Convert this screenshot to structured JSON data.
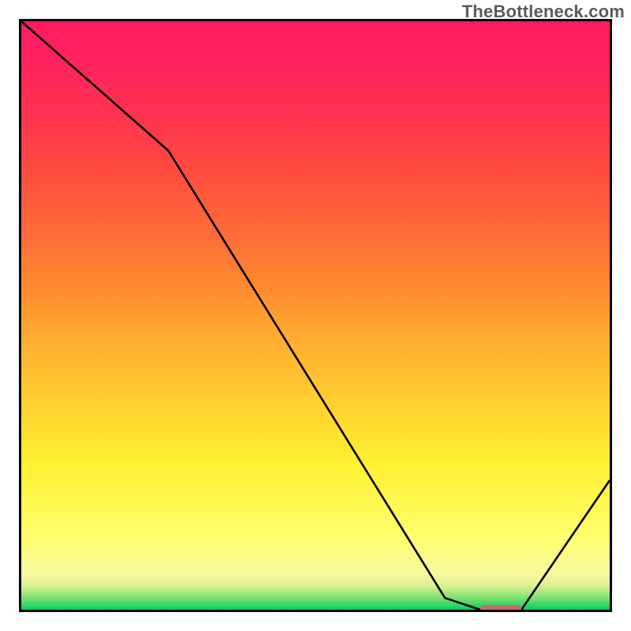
{
  "watermark": "TheBottleneck.com",
  "chart_data": {
    "type": "line",
    "title": "",
    "xlabel": "",
    "ylabel": "",
    "xlim": [
      0,
      100
    ],
    "ylim": [
      0,
      100
    ],
    "grid": false,
    "series": [
      {
        "name": "bottleneck-curve",
        "x": [
          0,
          25,
          72,
          78,
          85,
          100
        ],
        "values": [
          100,
          78,
          2,
          0,
          0,
          22
        ]
      }
    ],
    "annotations": [
      {
        "name": "optimal-marker",
        "x_range": [
          78,
          85
        ],
        "y": 0,
        "color": "#cc6a6a"
      }
    ],
    "background_gradient": {
      "direction": "bottom-to-top",
      "stops": [
        {
          "pct": 0,
          "color": "#00d060"
        },
        {
          "pct": 6,
          "color": "#f8f8a0"
        },
        {
          "pct": 25,
          "color": "#fff030"
        },
        {
          "pct": 55,
          "color": "#ff8a30"
        },
        {
          "pct": 75,
          "color": "#ff4a40"
        },
        {
          "pct": 100,
          "color": "#ff1b63"
        }
      ]
    }
  }
}
